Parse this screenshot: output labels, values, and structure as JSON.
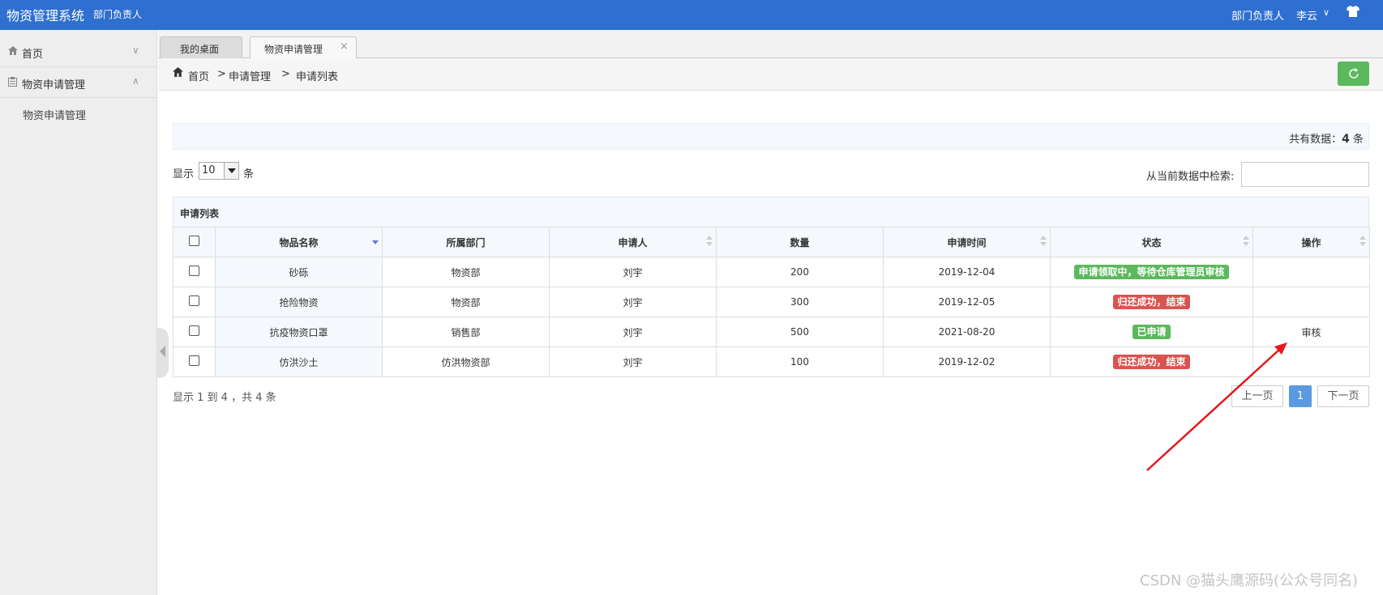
{
  "header": {
    "title": "物资管理系统",
    "subtitle": "部门负责人",
    "role": "部门负责人",
    "user": "李云",
    "user_chevron": "∨",
    "theme_icon": "shirt-icon",
    "bg_color": "#2f6fcf"
  },
  "sidebar": {
    "items": [
      {
        "label": "首页",
        "icon": "home-icon",
        "arrow": "∨"
      },
      {
        "label": "物资申请管理",
        "icon": "clipboard-icon",
        "arrow": "∧"
      }
    ],
    "sub_item": "物资申请管理"
  },
  "tabs": [
    {
      "label": "我的桌面"
    },
    {
      "label": "物资申请管理",
      "close": "×"
    }
  ],
  "breadcrumb": {
    "home": "首页",
    "sep": ">",
    "level2": "申请管理",
    "level3": "申请列表"
  },
  "summary": {
    "prefix": "共有数据：",
    "count": "4",
    "suffix": " 条"
  },
  "length": {
    "label": "显示",
    "value": "10",
    "unit": "条"
  },
  "search": {
    "label": "从当前数据中检索:",
    "value": ""
  },
  "table": {
    "caption": "申请列表",
    "columns": [
      "物品名称",
      "所属部门",
      "申请人",
      "数量",
      "申请时间",
      "状态",
      "操作"
    ],
    "rows": [
      {
        "name": "砂砾",
        "dept": "物资部",
        "applicant": "刘宇",
        "qty": "200",
        "date": "2019-12-04",
        "status": "申请领取中，等待仓库管理员审核",
        "status_color": "#5cb85c",
        "action": ""
      },
      {
        "name": "抢险物资",
        "dept": "物资部",
        "applicant": "刘宇",
        "qty": "300",
        "date": "2019-12-05",
        "status": "归还成功，结束",
        "status_color": "#d9534f",
        "action": ""
      },
      {
        "name": "抗疫物资口罩",
        "dept": "销售部",
        "applicant": "刘宇",
        "qty": "500",
        "date": "2021-08-20",
        "status": "已申请",
        "status_color": "#5cb85c",
        "action": "审核"
      },
      {
        "name": "仿洪沙土",
        "dept": "仿洪物资部",
        "applicant": "刘宇",
        "qty": "100",
        "date": "2019-12-02",
        "status": "归还成功，结束",
        "status_color": "#d9534f",
        "action": ""
      }
    ]
  },
  "footer": {
    "info": "显示 1 到 4 ，共 4 条",
    "prev": "上一页",
    "page": "1",
    "next": "下一页"
  },
  "watermark": "CSDN @猫头鹰源码(公众号同名)",
  "colors": {
    "accent": "#2f6fcf",
    "success": "#5cb85c",
    "danger": "#d9534f",
    "annotation_arrow": "#e8161c"
  }
}
